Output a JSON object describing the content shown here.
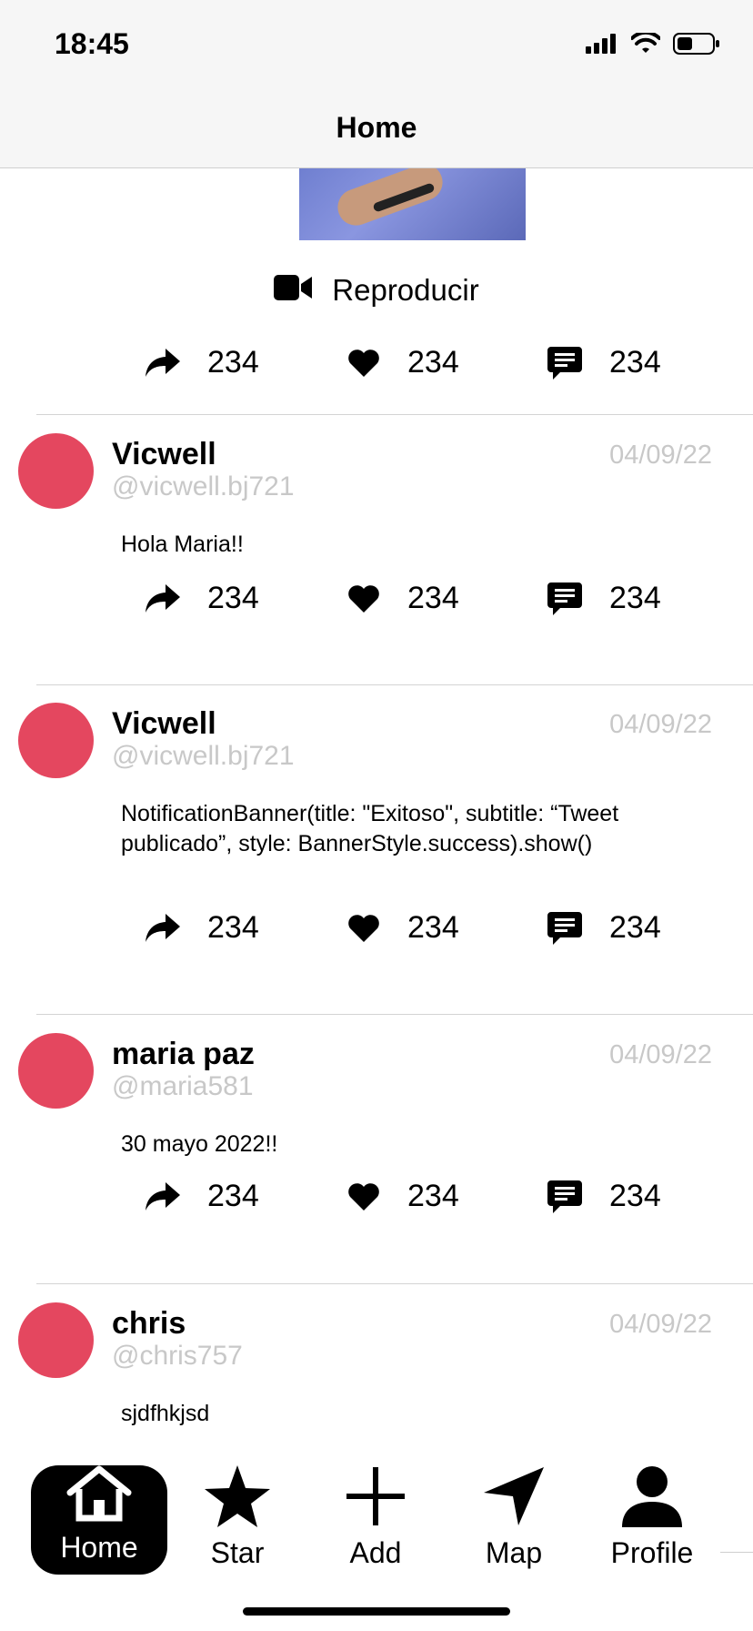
{
  "status_bar": {
    "time": "18:45"
  },
  "nav": {
    "title": "Home"
  },
  "media": {
    "play_label": "Reproducir"
  },
  "posts": [
    {
      "name": "Vicwell",
      "handle": "@vicwell.bj721",
      "date": "04/09/22",
      "text": "Hola Maria!!"
    },
    {
      "name": "Vicwell",
      "handle": "@vicwell.bj721",
      "date": "04/09/22",
      "text": "NotificationBanner(title: \"Exitoso\", subtitle: “Tweet publicado”, style: BannerStyle.success).show()"
    },
    {
      "name": "maria paz",
      "handle": "@maria581",
      "date": "04/09/22",
      "text": "30 mayo 2022!!"
    },
    {
      "name": "chris",
      "handle": "@chris757",
      "date": "04/09/22",
      "text": "sjdfhkjsd"
    }
  ],
  "actions": {
    "retweets": "234",
    "likes": "234",
    "comments": "234"
  },
  "tabs": [
    {
      "label": "Home",
      "icon": "house-icon",
      "active": true
    },
    {
      "label": "Star",
      "icon": "star-icon",
      "active": false
    },
    {
      "label": "Add",
      "icon": "plus-icon",
      "active": false
    },
    {
      "label": "Map",
      "icon": "location-arrow-icon",
      "active": false
    },
    {
      "label": "Profile",
      "icon": "person-icon",
      "active": false
    }
  ],
  "colors": {
    "avatar": "#e4475f",
    "muted_text": "#c8c8c8",
    "divider": "#d4d4d4"
  }
}
